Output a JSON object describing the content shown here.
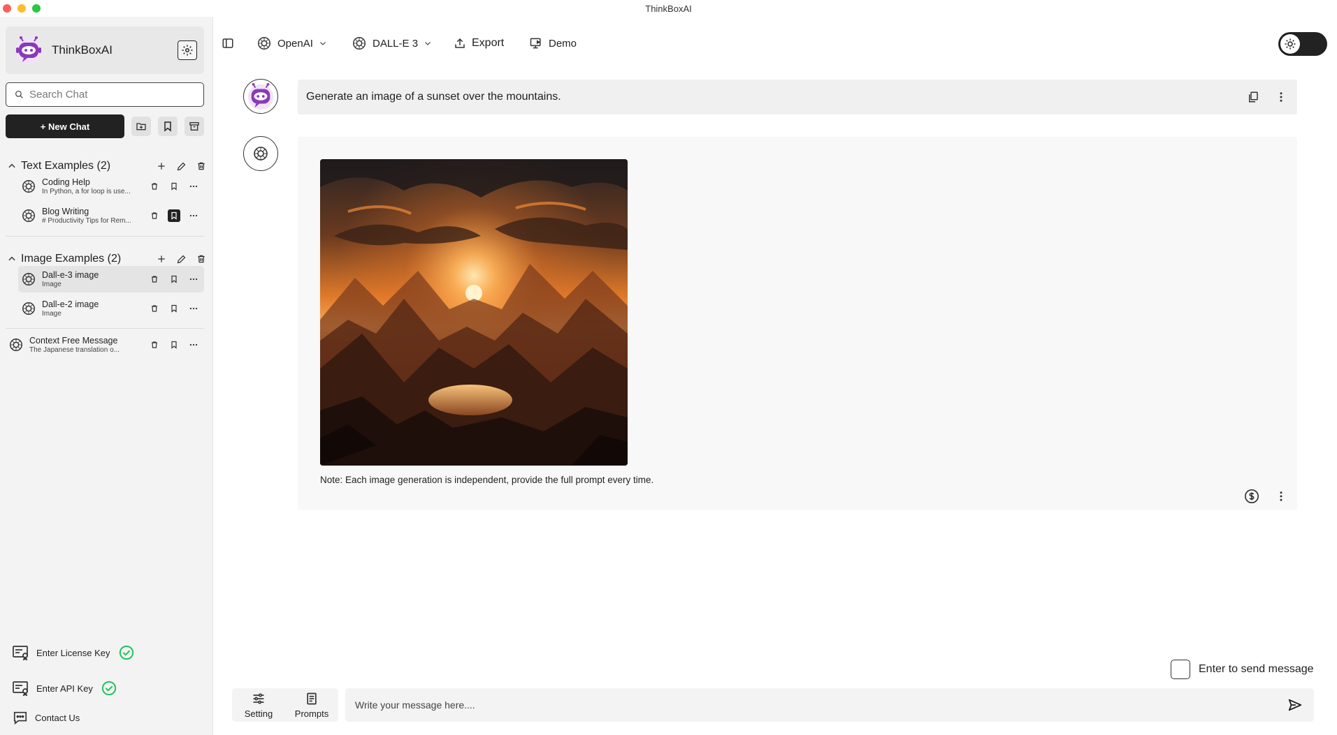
{
  "window": {
    "title": "ThinkBoxAI"
  },
  "sidebar": {
    "brand_name": "ThinkBoxAI",
    "search_placeholder": "Search Chat",
    "new_chat_label": "+ New Chat",
    "groups": [
      {
        "title": "Text Examples (2)",
        "items": [
          {
            "title": "Coding Help",
            "subtitle": "In Python, a for loop is use..."
          },
          {
            "title": "Blog Writing",
            "subtitle": "# Productivity Tips for Rem..."
          }
        ]
      },
      {
        "title": "Image Examples (2)",
        "items": [
          {
            "title": "Dall-e-3 image",
            "subtitle": "Image"
          },
          {
            "title": "Dall-e-2 image",
            "subtitle": "Image"
          }
        ]
      }
    ],
    "root_items": [
      {
        "title": "Context Free Message",
        "subtitle": "The Japanese translation o..."
      }
    ],
    "footer": {
      "license": "Enter License Key",
      "api_key": "Enter API Key",
      "contact": "Contact Us"
    }
  },
  "toolbar": {
    "provider": "OpenAI",
    "model": "DALL-E 3",
    "export": "Export",
    "demo": "Demo"
  },
  "chat": {
    "user_message": "Generate an image of a sunset over the mountains.",
    "bot_note": "Note: Each image generation is independent, provide the full prompt every time."
  },
  "composer": {
    "enter_to_send": "Enter to send message",
    "setting": "Setting",
    "prompts": "Prompts",
    "placeholder": "Write your message here...."
  },
  "colors": {
    "brand_purple": "#8a3ab9",
    "check_green": "#22c55e",
    "dark": "#222222"
  }
}
